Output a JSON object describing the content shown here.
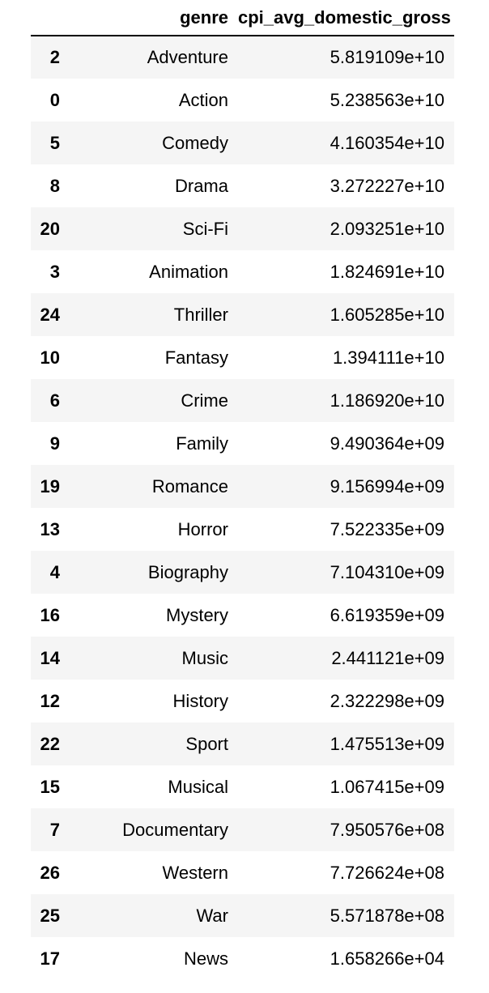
{
  "table": {
    "columns": {
      "index": "",
      "genre": "genre",
      "value": "cpi_avg_domestic_gross"
    },
    "rows": [
      {
        "index": "2",
        "genre": "Adventure",
        "value": "5.819109e+10"
      },
      {
        "index": "0",
        "genre": "Action",
        "value": "5.238563e+10"
      },
      {
        "index": "5",
        "genre": "Comedy",
        "value": "4.160354e+10"
      },
      {
        "index": "8",
        "genre": "Drama",
        "value": "3.272227e+10"
      },
      {
        "index": "20",
        "genre": "Sci-Fi",
        "value": "2.093251e+10"
      },
      {
        "index": "3",
        "genre": "Animation",
        "value": "1.824691e+10"
      },
      {
        "index": "24",
        "genre": "Thriller",
        "value": "1.605285e+10"
      },
      {
        "index": "10",
        "genre": "Fantasy",
        "value": "1.394111e+10"
      },
      {
        "index": "6",
        "genre": "Crime",
        "value": "1.186920e+10"
      },
      {
        "index": "9",
        "genre": "Family",
        "value": "9.490364e+09"
      },
      {
        "index": "19",
        "genre": "Romance",
        "value": "9.156994e+09"
      },
      {
        "index": "13",
        "genre": "Horror",
        "value": "7.522335e+09"
      },
      {
        "index": "4",
        "genre": "Biography",
        "value": "7.104310e+09"
      },
      {
        "index": "16",
        "genre": "Mystery",
        "value": "6.619359e+09"
      },
      {
        "index": "14",
        "genre": "Music",
        "value": "2.441121e+09"
      },
      {
        "index": "12",
        "genre": "History",
        "value": "2.322298e+09"
      },
      {
        "index": "22",
        "genre": "Sport",
        "value": "1.475513e+09"
      },
      {
        "index": "15",
        "genre": "Musical",
        "value": "1.067415e+09"
      },
      {
        "index": "7",
        "genre": "Documentary",
        "value": "7.950576e+08"
      },
      {
        "index": "26",
        "genre": "Western",
        "value": "7.726624e+08"
      },
      {
        "index": "25",
        "genre": "War",
        "value": "5.571878e+08"
      },
      {
        "index": "17",
        "genre": "News",
        "value": "1.658266e+04"
      }
    ]
  }
}
